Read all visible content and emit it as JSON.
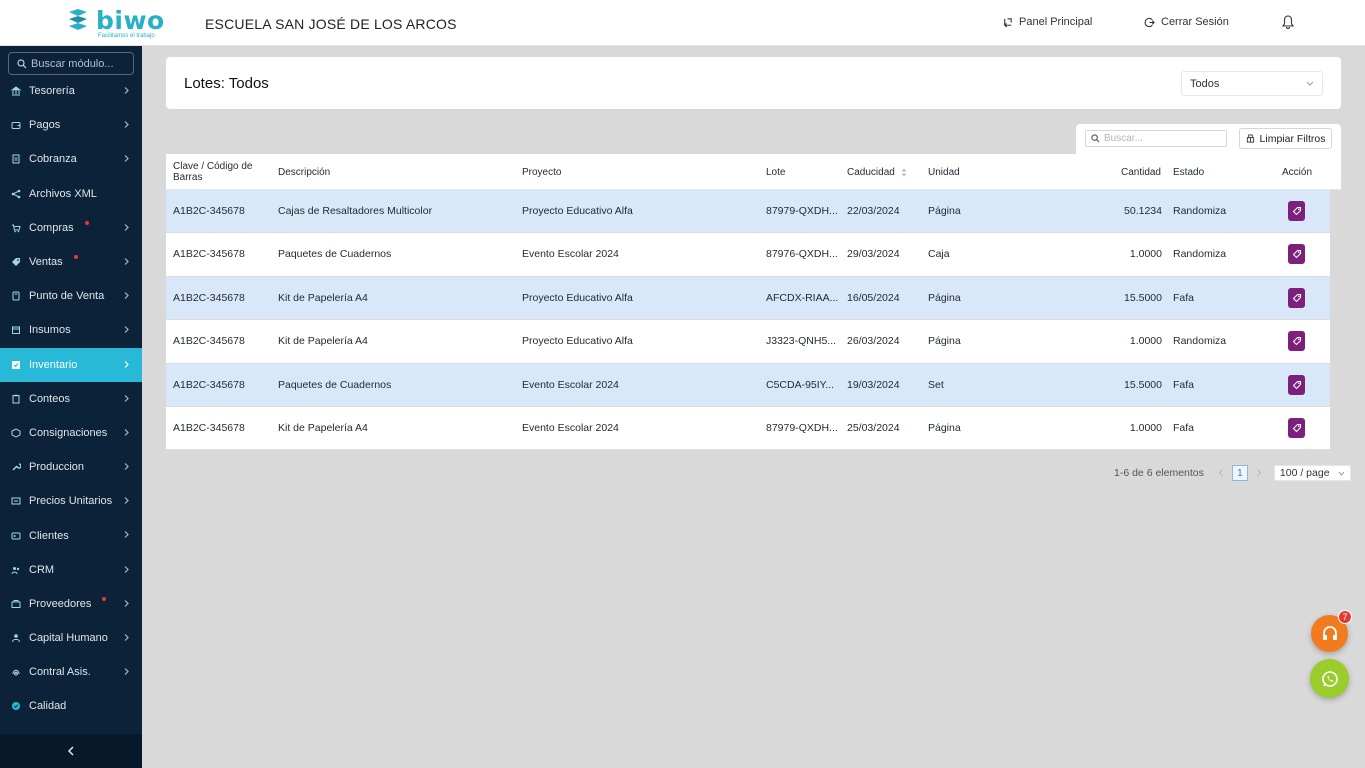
{
  "header": {
    "logo_text": "biwo",
    "logo_tagline": "Facilitamos el trabajo",
    "school_name": "ESCUELA SAN JOSÉ DE LOS ARCOS",
    "panel_label": "Panel Principal",
    "logout_label": "Cerrar Sesión"
  },
  "sidebar": {
    "search_placeholder": "Buscar módulo...",
    "items": [
      {
        "label": "Tesorería",
        "icon": "bank-icon",
        "has_chevron": true,
        "notify": false
      },
      {
        "label": "Pagos",
        "icon": "wallet-icon",
        "has_chevron": true,
        "notify": false
      },
      {
        "label": "Cobranza",
        "icon": "document-icon",
        "has_chevron": true,
        "notify": false
      },
      {
        "label": "Archivos XML",
        "icon": "share-icon",
        "has_chevron": false,
        "notify": false
      },
      {
        "label": "Compras",
        "icon": "cart-icon",
        "has_chevron": true,
        "notify": true
      },
      {
        "label": "Ventas",
        "icon": "tag-icon",
        "has_chevron": true,
        "notify": true
      },
      {
        "label": "Punto de Venta",
        "icon": "pos-icon",
        "has_chevron": true,
        "notify": false
      },
      {
        "label": "Insumos",
        "icon": "box-icon",
        "has_chevron": true,
        "notify": false
      },
      {
        "label": "Inventario",
        "icon": "inventory-icon",
        "has_chevron": true,
        "notify": false,
        "active": true
      },
      {
        "label": "Conteos",
        "icon": "clipboard-icon",
        "has_chevron": true,
        "notify": false
      },
      {
        "label": "Consignaciones",
        "icon": "consign-icon",
        "has_chevron": true,
        "notify": false
      },
      {
        "label": "Produccion",
        "icon": "wrench-icon",
        "has_chevron": true,
        "notify": false
      },
      {
        "label": "Precios Unitarios",
        "icon": "price-icon",
        "has_chevron": true,
        "notify": false
      },
      {
        "label": "Clientes",
        "icon": "id-card-icon",
        "has_chevron": true,
        "notify": false
      },
      {
        "label": "CRM",
        "icon": "users-icon",
        "has_chevron": true,
        "notify": false
      },
      {
        "label": "Proveedores",
        "icon": "supplier-icon",
        "has_chevron": true,
        "notify": true
      },
      {
        "label": "Capital Humano",
        "icon": "people-icon",
        "has_chevron": true,
        "notify": false
      },
      {
        "label": "Contral Asis.",
        "icon": "fingerprint-icon",
        "has_chevron": true,
        "notify": false
      },
      {
        "label": "Calidad",
        "icon": "badge-icon",
        "has_chevron": false,
        "notify": false
      }
    ]
  },
  "page": {
    "title": "Lotes: Todos",
    "filter_value": "Todos"
  },
  "toolbar": {
    "search_placeholder": "Buscar...",
    "clear_label": "Limpiar Filtros"
  },
  "table": {
    "headers": {
      "clave": "Clave / Código de Barras",
      "descripcion": "Descripción",
      "proyecto": "Proyecto",
      "lote": "Lote",
      "caducidad": "Caducidad",
      "unidad": "Unidad",
      "cantidad": "Cantidad",
      "estado": "Estado",
      "accion": "Acción"
    },
    "rows": [
      {
        "clave": "A1B2C-345678",
        "descripcion": "Cajas de Resaltadores Multicolor",
        "proyecto": "Proyecto Educativo Alfa",
        "lote": "87979-QXDH...",
        "caducidad": "22/03/2024",
        "unidad": "Página",
        "cantidad": "50.1234",
        "estado": "Randomiza"
      },
      {
        "clave": "A1B2C-345678",
        "descripcion": "Paquetes de Cuadernos",
        "proyecto": "Evento Escolar 2024",
        "lote": "87976-QXDH...",
        "caducidad": "29/03/2024",
        "unidad": "Caja",
        "cantidad": "1.0000",
        "estado": "Randomiza"
      },
      {
        "clave": "A1B2C-345678",
        "descripcion": "Kit de Papelería A4",
        "proyecto": "Proyecto Educativo Alfa",
        "lote": "AFCDX-RIAA...",
        "caducidad": "16/05/2024",
        "unidad": "Página",
        "cantidad": "15.5000",
        "estado": "Fafa"
      },
      {
        "clave": "A1B2C-345678",
        "descripcion": "Kit de Papelería A4",
        "proyecto": "Proyecto Educativo Alfa",
        "lote": "J3323-QNH5...",
        "caducidad": "26/03/2024",
        "unidad": "Página",
        "cantidad": "1.0000",
        "estado": "Randomiza"
      },
      {
        "clave": "A1B2C-345678",
        "descripcion": "Paquetes de Cuadernos",
        "proyecto": "Evento Escolar 2024",
        "lote": "C5CDA-95IY...",
        "caducidad": "19/03/2024",
        "unidad": "Set",
        "cantidad": "15.5000",
        "estado": "Fafa"
      },
      {
        "clave": "A1B2C-345678",
        "descripcion": "Kit de Papelería A4",
        "proyecto": "Evento Escolar 2024",
        "lote": "87979-QXDH...",
        "caducidad": "25/03/2024",
        "unidad": "Página",
        "cantidad": "1.0000",
        "estado": "Fafa"
      }
    ]
  },
  "pagination": {
    "range_label": "1-6 de 6 elementos",
    "current_page": "1",
    "page_size": "100 / page"
  },
  "fab": {
    "support_badge": "7"
  },
  "colors": {
    "brand": "#27b1c9",
    "sidebar_bg": "#0b2238",
    "active_item": "#28b8d8",
    "row_highlight": "#d8e8f8",
    "action_button": "#7c1f7d",
    "support_fab": "#f27b20",
    "whatsapp_fab": "#9acd2c",
    "notify_dot": "#e53935"
  }
}
